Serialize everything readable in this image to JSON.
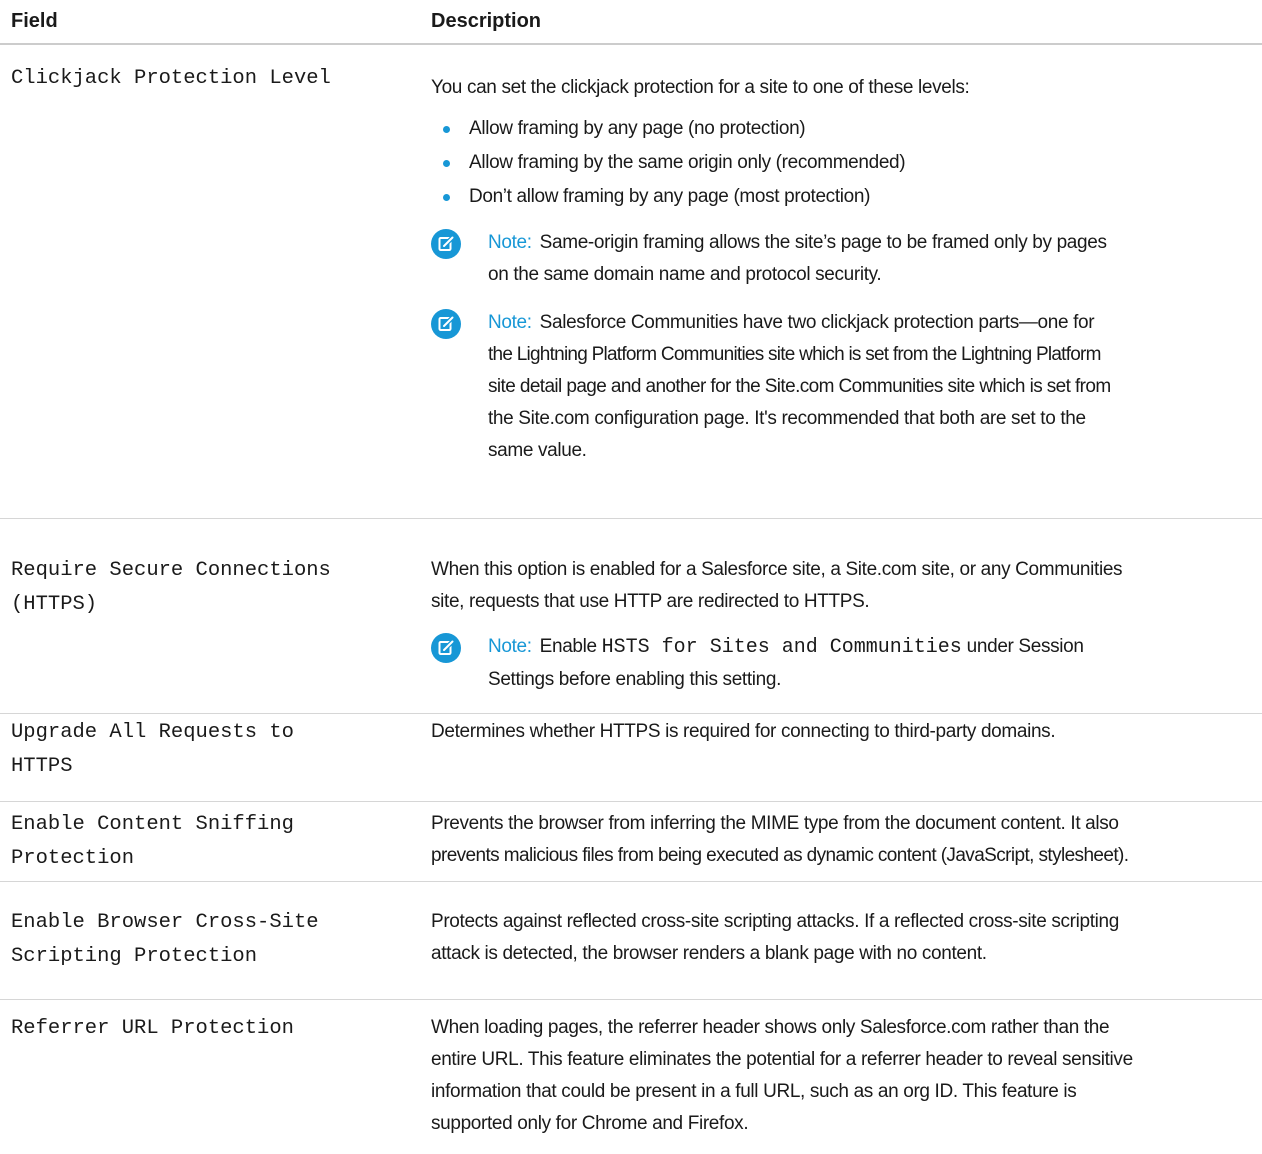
{
  "header": {
    "field": "Field",
    "description": "Description"
  },
  "colors": {
    "accent": "#1797d6",
    "text": "#1a1a1a",
    "divider": "#d6d6d6"
  },
  "rows": {
    "clickjack": {
      "field": "Clickjack Protection Level",
      "intro": "You can set the clickjack protection for a site to one of these levels:",
      "bullets": [
        "Allow framing by any page (no protection)",
        "Allow framing by the same origin only (recommended)",
        "Don’t allow framing by any page (most protection)"
      ],
      "note1": {
        "label": "Note:",
        "line1": "Same-origin framing allows the site’s page to be framed only by pages",
        "line2": "on the same domain name and protocol security."
      },
      "note2": {
        "label": "Note:",
        "line1": "Salesforce Communities have two clickjack protection parts—one for",
        "line2": "the Lightning Platform Communities site which is set from the Lightning Platform",
        "line3": "site detail page and another for the Site.com Communities site which is set from",
        "line4": "the Site.com configuration page. It's recommended that both are set to the",
        "line5": "same value."
      }
    },
    "https": {
      "field": "Require Secure Connections\n(HTTPS)",
      "line1": "When this option is enabled for a Salesforce site, a Site.com site, or any Communities",
      "line2": "site, requests that use HTTP are redirected to HTTPS.",
      "note": {
        "label": "Note:",
        "before": "Enable ",
        "code": "HSTS for Sites and Communities",
        "after": " under Session",
        "line2": "Settings before enabling this setting."
      }
    },
    "upgrade": {
      "field": "Upgrade All Requests to\nHTTPS",
      "line1": "Determines whether HTTPS is required for connecting to third-party domains."
    },
    "sniffing": {
      "field": "Enable Content Sniffing\nProtection",
      "line1": "Prevents the browser from inferring the MIME type from the document content. It also",
      "line2": "prevents malicious files from being executed as dynamic content (JavaScript, stylesheet)."
    },
    "xss": {
      "field": "Enable Browser Cross-Site\nScripting Protection",
      "line1": "Protects against reflected cross-site scripting attacks. If a reflected cross-site scripting",
      "line2": "attack is detected, the browser renders a blank page with no content."
    },
    "referrer": {
      "field": "Referrer URL Protection",
      "line1": "When loading pages, the referrer header shows only Salesforce.com rather than the",
      "line2": "entire URL. This feature eliminates the potential for a referrer header to reveal sensitive",
      "line3": "information that could be present in a full URL, such as an org ID. This feature is",
      "line4": "supported only for Chrome and Firefox."
    }
  }
}
